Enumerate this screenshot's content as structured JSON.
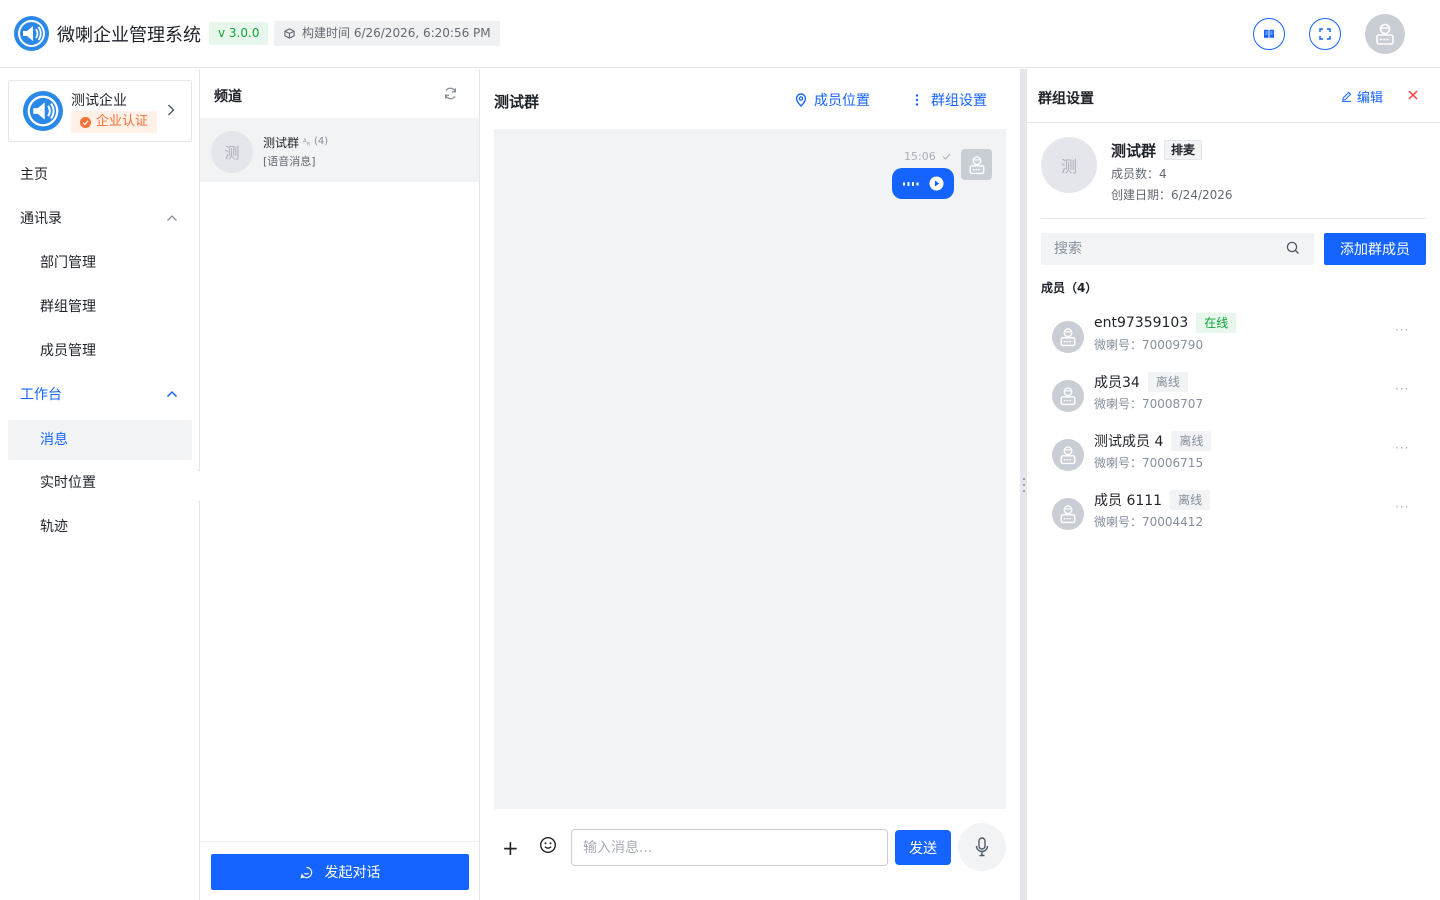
{
  "header": {
    "app_title": "微喇企业管理系统",
    "version": "v 3.0.0",
    "build_time": "构建时间 6/26/2026, 6:20:56 PM"
  },
  "sidebar": {
    "enterprise_name": "测试企业",
    "enterprise_badge": "企业认证",
    "menu": {
      "home": "主页",
      "contacts": "通讯录",
      "dept": "部门管理",
      "groups": "群组管理",
      "members": "成员管理",
      "workbench": "工作台",
      "messages": "消息",
      "location": "实时位置",
      "tracks": "轨迹"
    }
  },
  "channels": {
    "title": "频道",
    "item": {
      "avatar_text": "测",
      "name": "测试群",
      "count": "(4)",
      "last_message": "[语音消息]"
    },
    "start_button": "发起对话"
  },
  "chat": {
    "title": "测试群",
    "member_location": "成员位置",
    "group_settings": "群组设置",
    "message": {
      "time": "15:06"
    },
    "composer": {
      "plus": "+",
      "placeholder": "输入消息...",
      "send": "发送"
    }
  },
  "panel": {
    "title": "群组设置",
    "edit": "编辑",
    "group": {
      "avatar_text": "测",
      "name": "测试群",
      "tag": "排麦",
      "member_count": "成员数：4",
      "created": "创建日期：6/24/2026"
    },
    "search_placeholder": "搜索",
    "add_button": "添加群成员",
    "members_title": "成员（4）",
    "members": [
      {
        "name": "ent97359103",
        "status": "在线",
        "online": true,
        "id": "微喇号：70009790"
      },
      {
        "name": "成员34",
        "status": "离线",
        "online": false,
        "id": "微喇号：70008707"
      },
      {
        "name": "测试成员 4",
        "status": "离线",
        "online": false,
        "id": "微喇号：70006715"
      },
      {
        "name": "成员 6111",
        "status": "离线",
        "online": false,
        "id": "微喇号：70004412"
      }
    ],
    "more": "···"
  },
  "colors": {
    "primary": "#1664ff",
    "online": "#0fa53a",
    "certified": "#f77234"
  }
}
